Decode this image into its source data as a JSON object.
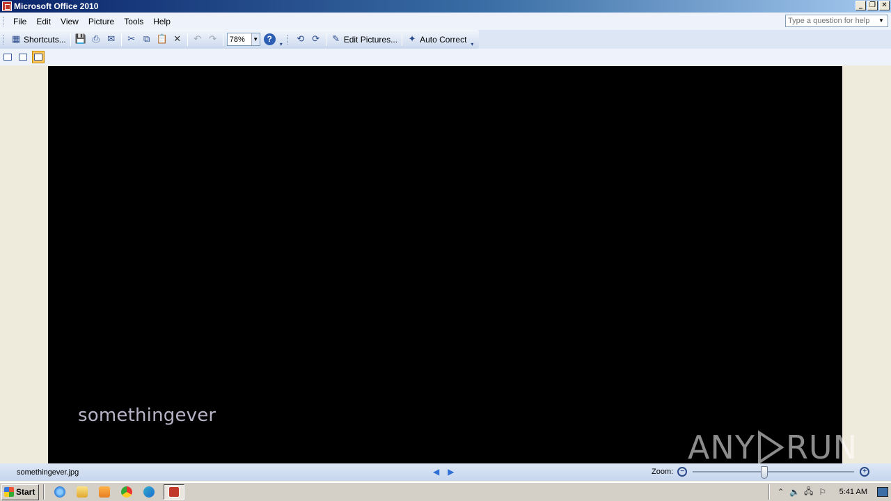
{
  "window": {
    "title": "Microsoft Office 2010"
  },
  "menu": {
    "items": [
      "File",
      "Edit",
      "View",
      "Picture",
      "Tools",
      "Help"
    ],
    "help_placeholder": "Type a question for help"
  },
  "toolbar": {
    "shortcuts_label": "Shortcuts...",
    "zoom_value": "78%",
    "edit_pictures_label": "Edit Pictures...",
    "auto_correct_label": "Auto Correct"
  },
  "image": {
    "caption": "somethingever",
    "watermark_left": "ANY",
    "watermark_right": "RUN"
  },
  "status": {
    "filename": "somethingever.jpg",
    "zoom_label": "Zoom:",
    "zoom_slider_fraction": 0.44
  },
  "taskbar": {
    "start_label": "Start",
    "clock": "5:41 AM"
  },
  "colors": {
    "title_gradient_start": "#0a246a",
    "image_background": "#000000",
    "caption_text": "#b9b3c7"
  }
}
